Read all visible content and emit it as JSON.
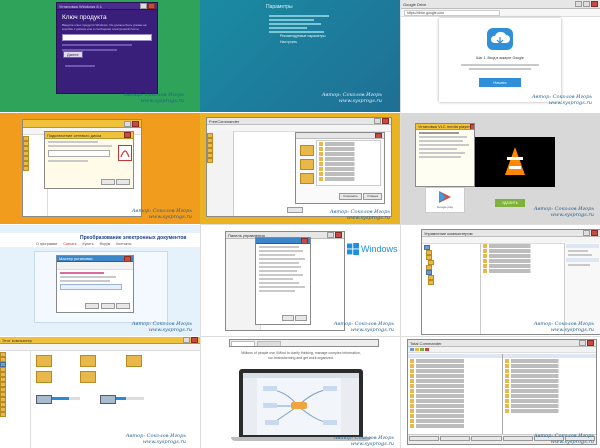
{
  "tiles": [
    {
      "id": "t1",
      "kind": "key-dialog",
      "bg": "#2fa35a",
      "window_title": "Установка Windows 8.1",
      "heading": "Ключ продукта",
      "body": "Введите ключ продукта Windows. Он должен быть указан на коробке с диском или в сообщении электронной почты.",
      "field": "",
      "button": "Далее",
      "signature": [
        "Автор: Соколов Игорь",
        "www.sysprogs.ru"
      ]
    },
    {
      "id": "t2",
      "kind": "oobe",
      "bg": "#1f7fa0",
      "heading": "Параметры",
      "lines": [
        "Рекомендуемые параметры",
        "Настроить"
      ],
      "signature": [
        "Автор: Соколов Игорь",
        "www.sysprogs.ru"
      ]
    },
    {
      "id": "t3",
      "kind": "browser-store",
      "bg": "#ffffff",
      "tab": "Google Drive",
      "url": "https://drive.google.com",
      "promo": "Шаг 1. Вход в аккаунт Google",
      "button": "Начать",
      "signature": [
        "Автор: Соколов Игорь",
        "www.sysprogs.ru"
      ]
    },
    {
      "id": "t4",
      "kind": "explorer-props",
      "bg": "#f29c1e",
      "window_title": "Подключение сетевого диска",
      "signature": [
        "Автор: Соколов Игорь",
        "www.sysprogs.ru"
      ]
    },
    {
      "id": "t5",
      "kind": "file-manager",
      "bg": "#e9b322",
      "window_title": "FreeCommander",
      "ok": "Сохранить",
      "cancel": "Отмена",
      "signature": [
        "Автор: Соколов Игорь",
        "www.sysprogs.ru"
      ]
    },
    {
      "id": "t6",
      "kind": "installer-vlc",
      "bg": "#d7d7d7",
      "window_title": "Установка VLC media player",
      "store_label": "Google play",
      "button": "УДАЛИТЬ",
      "signature": [
        "Автор: Соколов Игорь",
        "www.sysprogs.ru"
      ]
    },
    {
      "id": "t7",
      "kind": "web-docs",
      "bg": "#e5f1fb",
      "site_title": "Преобразование электронных документов",
      "nav": [
        "О программе",
        "Скачать",
        "Купить",
        "Форум",
        "Контакты"
      ],
      "dialog_title": "Мастер установки",
      "signature": [
        "Автор: Соколов Игорь",
        "www.sysprogs.ru"
      ]
    },
    {
      "id": "t8",
      "kind": "settings-win8",
      "bg": "#ffffff",
      "window_title": "Панель управления",
      "logo": "Windows 8",
      "signature": [
        "Автор: Соколов Игорь",
        "www.sysprogs.ru"
      ]
    },
    {
      "id": "t9",
      "kind": "mmc",
      "bg": "#ffffff",
      "window_title": "Управление компьютером",
      "signature": [
        "Автор: Соколов Игорь",
        "www.sysprogs.ru"
      ]
    },
    {
      "id": "t10",
      "kind": "explorer",
      "bg": "#ffffff",
      "window_title": "Этот компьютер",
      "signature": [
        "Автор: Соколов Игорь",
        "www.sysprogs.ru"
      ]
    },
    {
      "id": "t11",
      "kind": "mindmap",
      "bg": "#ffffff",
      "caption": "Millions of people use XMind to clarify thinking, manage complex information, run brainstorming and get work organized.",
      "signature": [
        "Автор: Соколов Игорь",
        "www.sysprogs.ru"
      ]
    },
    {
      "id": "t12",
      "kind": "dual-pane",
      "bg": "#ffffff",
      "window_title": "Total Commander",
      "signature": [
        "Автор: Соколов Игорь",
        "www.sysprogs.ru"
      ]
    }
  ]
}
